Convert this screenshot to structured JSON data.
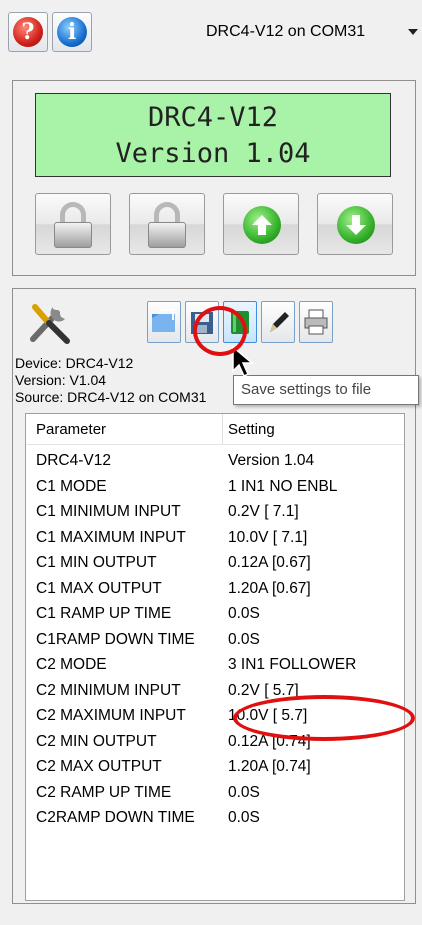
{
  "toolbar": {
    "help_icon": "?",
    "info_icon": "i",
    "device_selected": "DRC4-V12 on COM31"
  },
  "lcd": {
    "line1": "DRC4-V12",
    "line2": "Version 1.04",
    "background": "#a9f3a9"
  },
  "controls": {
    "icons": [
      "lock-icon",
      "lock-icon",
      "arrow-up-icon",
      "arrow-down-icon"
    ]
  },
  "settings": {
    "device_line": "Device: DRC4-V12",
    "version_line": "Version: V1.04",
    "source_line": "Source: DRC4-V12 on COM31",
    "tooltip": "Save settings to file",
    "buttons": [
      "open-folder-icon",
      "save-disk-icon",
      "book-icon",
      "pencil-icon",
      "printer-icon"
    ]
  },
  "table": {
    "headers": [
      "Parameter",
      "Setting"
    ],
    "rows": [
      {
        "param": "DRC4-V12",
        "setting": "Version 1.04"
      },
      {
        "param": "C1 MODE",
        "setting": "1 IN1 NO ENBL"
      },
      {
        "param": "C1 MINIMUM INPUT",
        "setting": "0.2V [  7.1]"
      },
      {
        "param": "C1 MAXIMUM INPUT",
        "setting": "10.0V [  7.1]"
      },
      {
        "param": "C1 MIN OUTPUT",
        "setting": "0.12A [0.67]"
      },
      {
        "param": "C1 MAX OUTPUT",
        "setting": "1.20A [0.67]"
      },
      {
        "param": "C1 RAMP UP TIME",
        "setting": "0.0S"
      },
      {
        "param": "C1RAMP DOWN TIME",
        "setting": "0.0S"
      },
      {
        "param": "C2 MODE",
        "setting": "3 IN1 FOLLOWER"
      },
      {
        "param": "C2 MINIMUM INPUT",
        "setting": "0.2V [  5.7]"
      },
      {
        "param": "C2 MAXIMUM INPUT",
        "setting": "10.0V [  5.7]"
      },
      {
        "param": "C2 MIN OUTPUT",
        "setting": "0.12A [0.74]"
      },
      {
        "param": "C2 MAX OUTPUT",
        "setting": "1.20A [0.74]"
      },
      {
        "param": "C2 RAMP UP TIME",
        "setting": "0.0S"
      },
      {
        "param": "C2RAMP DOWN TIME",
        "setting": "0.0S"
      }
    ]
  },
  "highlight_color": "#e01010"
}
